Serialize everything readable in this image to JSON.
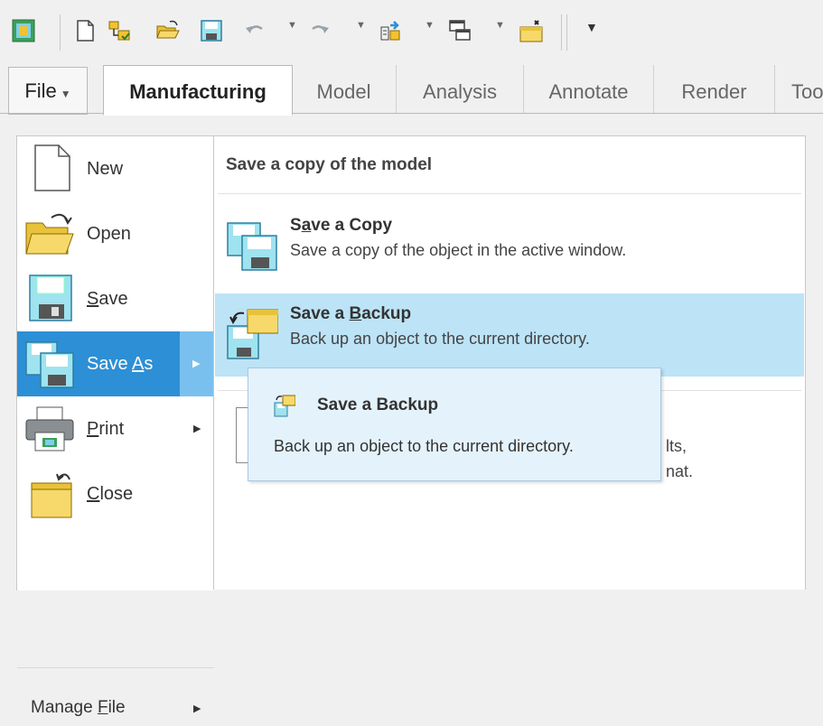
{
  "toolbar": {
    "icons": [
      "app-icon",
      "new-icon",
      "new-session-icon",
      "open-icon",
      "save-icon",
      "undo-icon",
      "redo-icon",
      "regenerate-icon",
      "windows-icon",
      "close-window-icon",
      "customize-icon"
    ]
  },
  "tabs": {
    "file": "File",
    "items": [
      "Manufacturing",
      "Model",
      "Analysis",
      "Annotate",
      "Render",
      "Too"
    ]
  },
  "menu": {
    "new": "New",
    "open": "Open",
    "save": "Save",
    "save_as": "Save As",
    "print": "Print",
    "close": "Close",
    "manage_file": "Manage File"
  },
  "panel": {
    "title": "Save a copy of the model",
    "options": [
      {
        "title": "Save a Copy",
        "desc": "Save a copy of the object in the active window."
      },
      {
        "title": "Save a Backup",
        "desc": "Back up an object to the current directory."
      }
    ],
    "hidden_line1": "lts,",
    "hidden_line2": "nat."
  },
  "tooltip": {
    "title": "Save a Backup",
    "desc": "Back up an object to the current directory."
  },
  "colors": {
    "selected_menu": "#2d8fd5",
    "highlight": "#bde3f6",
    "tooltip_bg": "#e4f2fb"
  }
}
